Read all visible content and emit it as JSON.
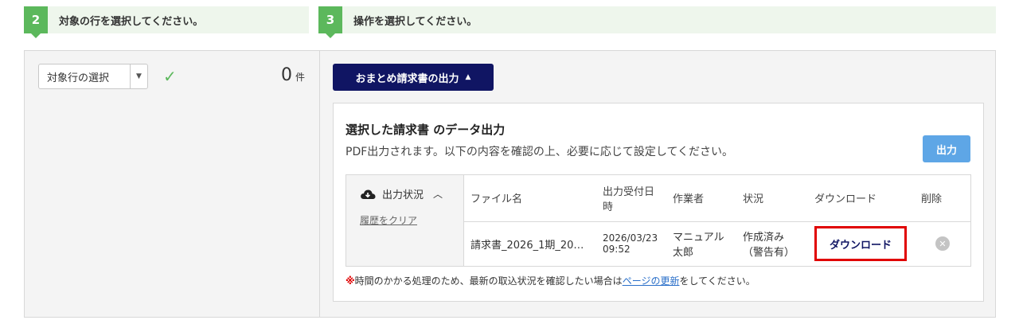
{
  "steps": {
    "step2": {
      "num": "2",
      "label": "対象の行を選択してください。"
    },
    "step3": {
      "num": "3",
      "label": "操作を選択してください。"
    }
  },
  "left": {
    "select_label": "対象行の選択",
    "count": "0",
    "count_unit": "件"
  },
  "right": {
    "export_button": "おまとめ請求書の出力",
    "panel_title": "選択した請求書 のデータ出力",
    "panel_desc": "PDF出力されます。以下の内容を確認の上、必要に応じて設定してください。",
    "output_button": "出力",
    "status": {
      "title": "出力状況",
      "clear_link": "履歴をクリア"
    },
    "table": {
      "headers": {
        "filename": "ファイル名",
        "received": "出力受付日時",
        "worker": "作業者",
        "state": "状況",
        "download": "ダウンロード",
        "delete": "削除"
      },
      "rows": [
        {
          "filename": "請求書_2026_1期_20…",
          "received_date": "2026/03/23",
          "received_time": "09:52",
          "worker_line1": "マニュアル",
          "worker_line2": "太郎",
          "state_line1": "作成済み",
          "state_line2": "（警告有）",
          "download": "ダウンロード"
        }
      ]
    },
    "note": {
      "mark": "※",
      "text_before": "時間のかかる処理のため、最新の取込状況を確認したい場合は",
      "link": "ページの更新",
      "text_after": "をしてください。"
    }
  },
  "colors": {
    "step_green": "#5cb85c",
    "navy": "#101563",
    "blue_button": "#5ea6e6",
    "highlight_red": "#e00000"
  },
  "icons": [
    "check-icon",
    "cloud-download-icon",
    "chevron-up-icon",
    "delete-icon",
    "caret-down-icon"
  ]
}
